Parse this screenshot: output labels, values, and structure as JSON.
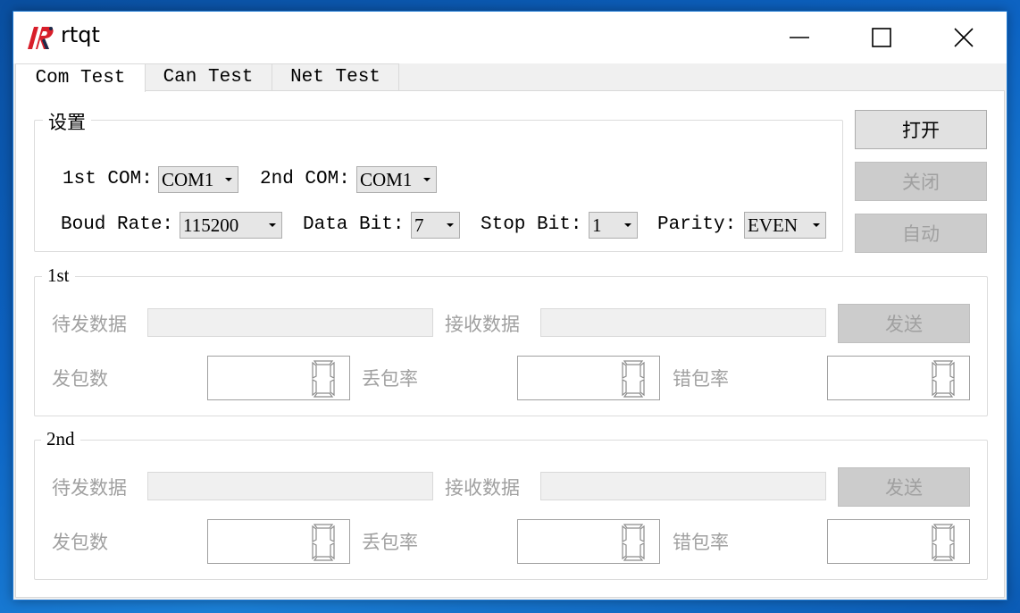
{
  "window": {
    "title": "rtqt"
  },
  "tabs": [
    {
      "label": "Com Test",
      "active": true
    },
    {
      "label": "Can Test",
      "active": false
    },
    {
      "label": "Net Test",
      "active": false
    }
  ],
  "settings": {
    "title": "设置",
    "first_com": {
      "label": "1st COM:",
      "value": "COM1"
    },
    "second_com": {
      "label": "2nd COM:",
      "value": "COM1"
    },
    "baud_rate": {
      "label": "Boud Rate:",
      "value": "115200"
    },
    "data_bit": {
      "label": "Data Bit:",
      "value": "7"
    },
    "stop_bit": {
      "label": "Stop Bit:",
      "value": "1"
    },
    "parity": {
      "label": "Parity:",
      "value": "EVEN"
    }
  },
  "actions": {
    "open": "打开",
    "close": "关闭",
    "auto": "自动"
  },
  "groups": [
    {
      "title": "1st",
      "send_label": "待发数据",
      "send_value": "",
      "recv_label": "接收数据",
      "recv_value": "",
      "send_button": "发送",
      "sent_packets_label": "发包数",
      "sent_packets": "0",
      "loss_rate_label": "丢包率",
      "loss_rate": "0",
      "error_rate_label": "错包率",
      "error_rate": "0"
    },
    {
      "title": "2nd",
      "send_label": "待发数据",
      "send_value": "",
      "recv_label": "接收数据",
      "recv_value": "",
      "send_button": "发送",
      "sent_packets_label": "发包数",
      "sent_packets": "0",
      "loss_rate_label": "丢包率",
      "loss_rate": "0",
      "error_rate_label": "错包率",
      "error_rate": "0"
    }
  ],
  "colors": {
    "desktop": "#0d64c4",
    "window_border": "#1e79d3",
    "disabled_text": "#a0a0a0",
    "lcd_segment": "#8c8c8c",
    "logo_red": "#d81e2a",
    "logo_navy": "#1b2a4a"
  },
  "icons": [
    "app-logo-icon",
    "minimize-icon",
    "maximize-icon",
    "close-icon",
    "dropdown-arrow-icon"
  ]
}
